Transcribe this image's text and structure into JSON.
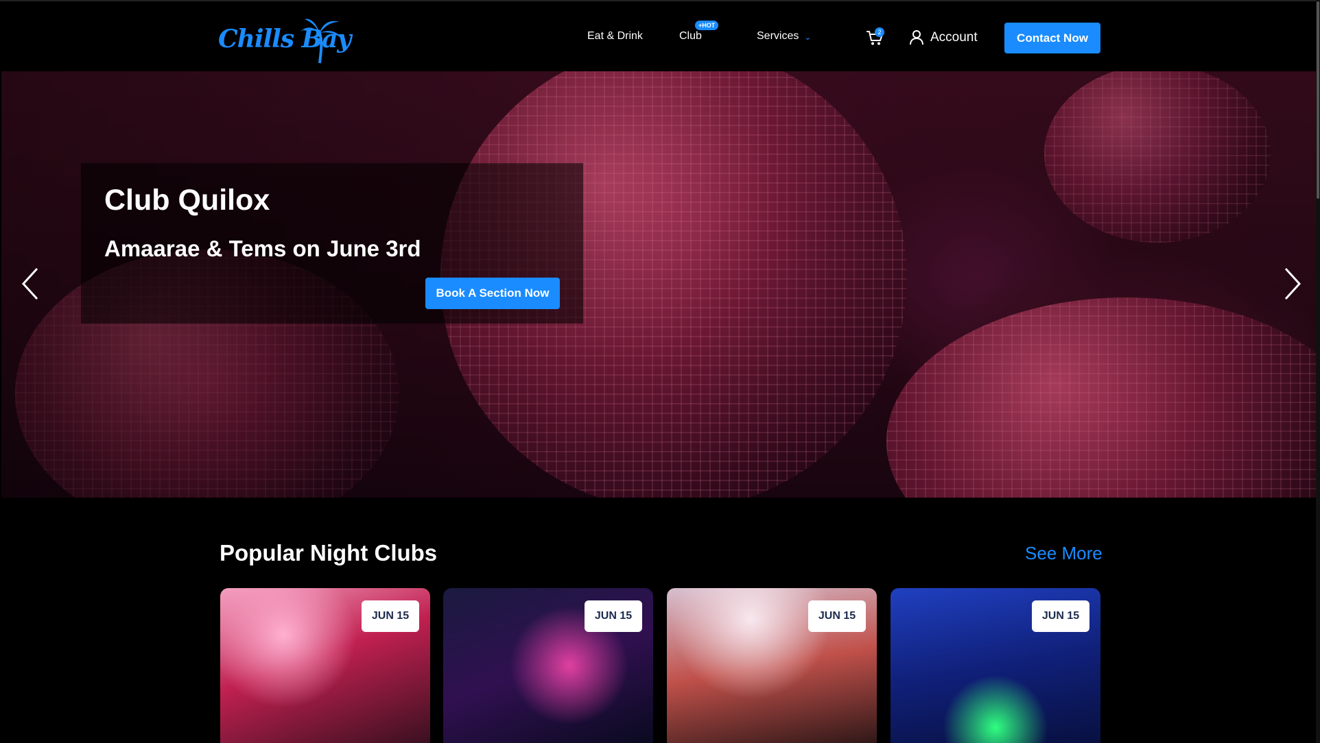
{
  "brand": {
    "name": "Chills Bay",
    "accent_color": "#1a8cff"
  },
  "nav": {
    "eat_drink": "Eat & Drink",
    "club": "Club",
    "club_badge": "+HOT",
    "services": "Services",
    "services_icon": "chevron-down-icon",
    "cart_icon": "cart-icon",
    "cart_count": "2",
    "account_icon": "user-icon",
    "account": "Account",
    "contact_button": "Contact Now"
  },
  "hero": {
    "title": "Club Quilox",
    "subtitle": "Amaarae & Tems on June 3rd",
    "cta_button": "Book A Section Now",
    "prev_icon": "chevron-left-icon",
    "next_icon": "chevron-right-icon"
  },
  "popular": {
    "title": "Popular Night Clubs",
    "see_more": "See More",
    "cards": [
      {
        "date": "JUN 15"
      },
      {
        "date": "JUN 15"
      },
      {
        "date": "JUN 15"
      },
      {
        "date": "JUN 15"
      }
    ]
  }
}
